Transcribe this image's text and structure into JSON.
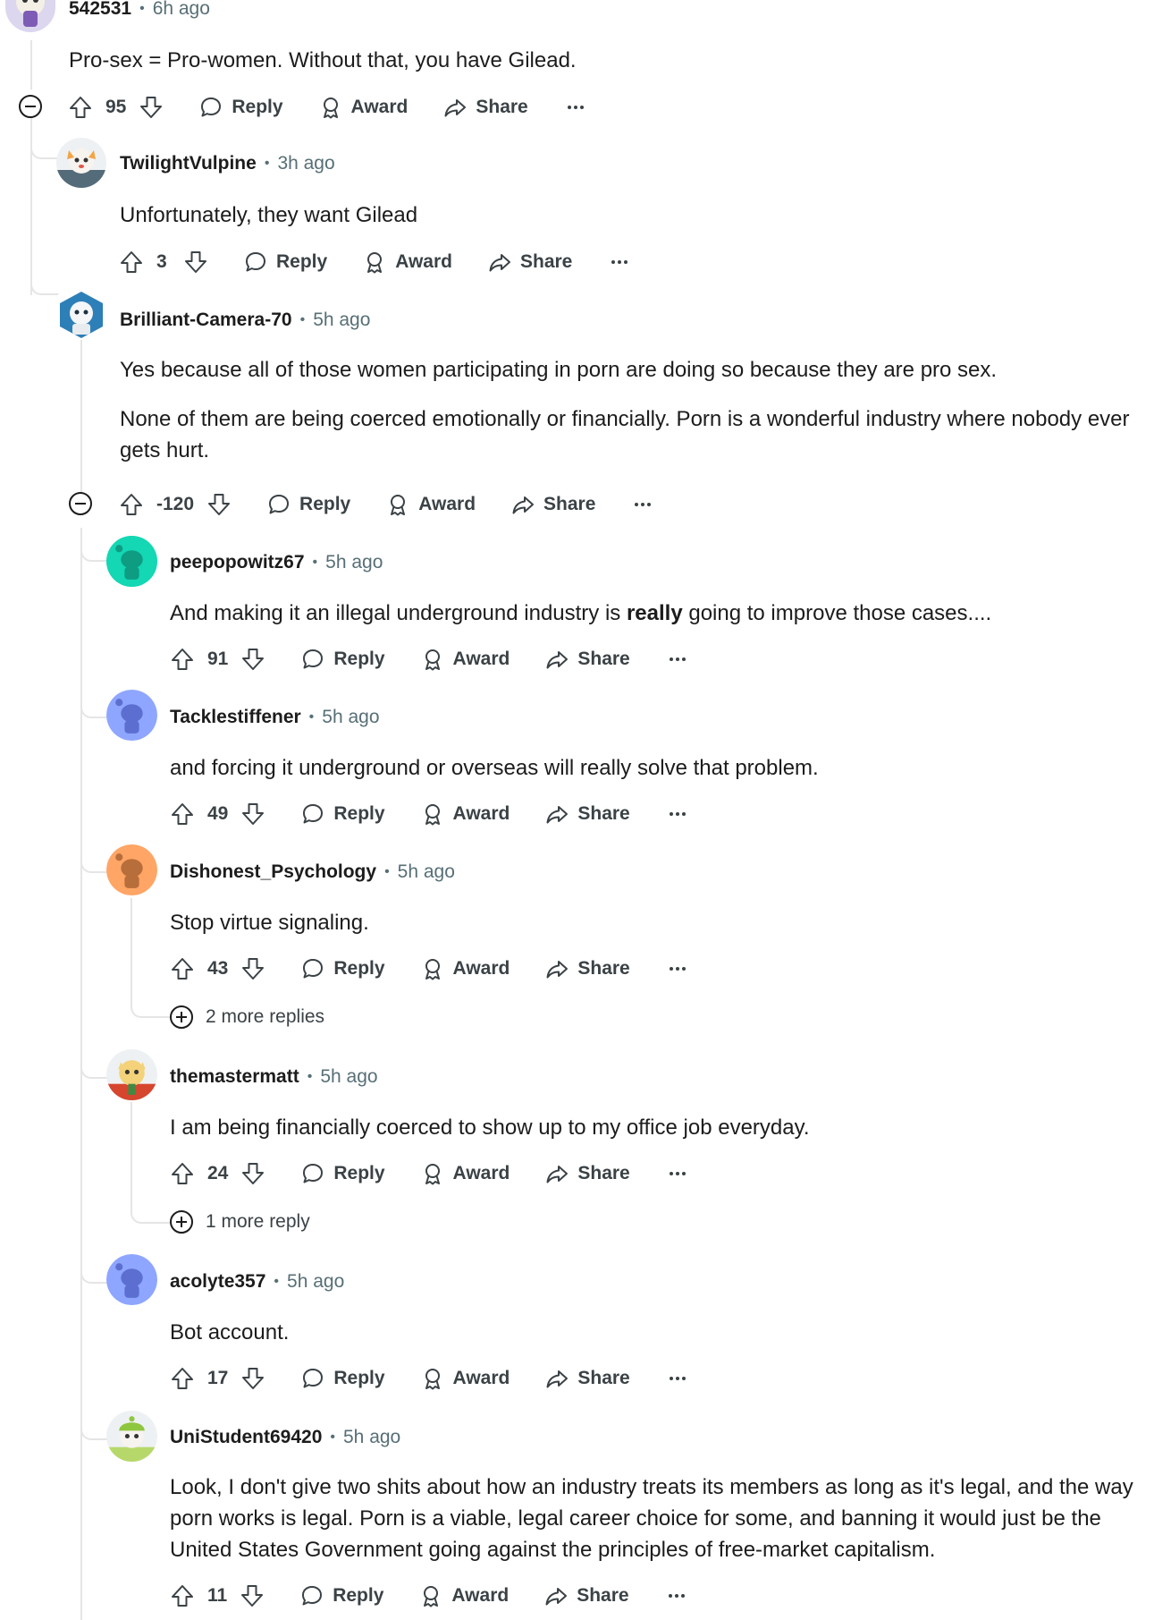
{
  "labels": {
    "reply": "Reply",
    "award": "Award",
    "share": "Share"
  },
  "comments": [
    {
      "author": "542531",
      "time": "6h ago",
      "body": [
        "Pro-sex = Pro-women. Without that, you have Gilead."
      ],
      "score": "95"
    },
    {
      "author": "TwilightVulpine",
      "time": "3h ago",
      "body": [
        "Unfortunately, they want Gilead"
      ],
      "score": "3"
    },
    {
      "author": "Brilliant-Camera-70",
      "time": "5h ago",
      "body": [
        "Yes because all of those women participating in porn are doing so because they are pro sex.",
        "None of them are being coerced emotionally or financially. Porn is a wonderful industry where nobody ever gets hurt."
      ],
      "score": "-120"
    },
    {
      "author": "peepopowitz67",
      "time": "5h ago",
      "body_parts": [
        "And making it an illegal underground industry is ",
        "really",
        " going to improve those cases...."
      ],
      "score": "91"
    },
    {
      "author": "Tacklestiffener",
      "time": "5h ago",
      "body": [
        "and forcing it underground or overseas will really solve that problem."
      ],
      "score": "49"
    },
    {
      "author": "Dishonest_Psychology",
      "time": "5h ago",
      "body": [
        "Stop virtue signaling."
      ],
      "score": "43",
      "more_replies": "2 more replies"
    },
    {
      "author": "themastermatt",
      "time": "5h ago",
      "body": [
        "I am being financially coerced to show up to my office job everyday."
      ],
      "score": "24",
      "more_replies": "1 more reply"
    },
    {
      "author": "acolyte357",
      "time": "5h ago",
      "body": [
        "Bot account."
      ],
      "score": "17"
    },
    {
      "author": "UniStudent69420",
      "time": "5h ago",
      "body": [
        "Look, I don't give two shits about how an industry treats its members as long as it's legal, and the way porn works is legal. Porn is a viable, legal career choice for some, and banning it would just be the United States Government going against the principles of free-market capitalism."
      ],
      "score": "11"
    }
  ],
  "colors": {
    "accent_line": "#e5e5e5",
    "meta_gray": "#576f76",
    "text": "#1c1c1c"
  }
}
